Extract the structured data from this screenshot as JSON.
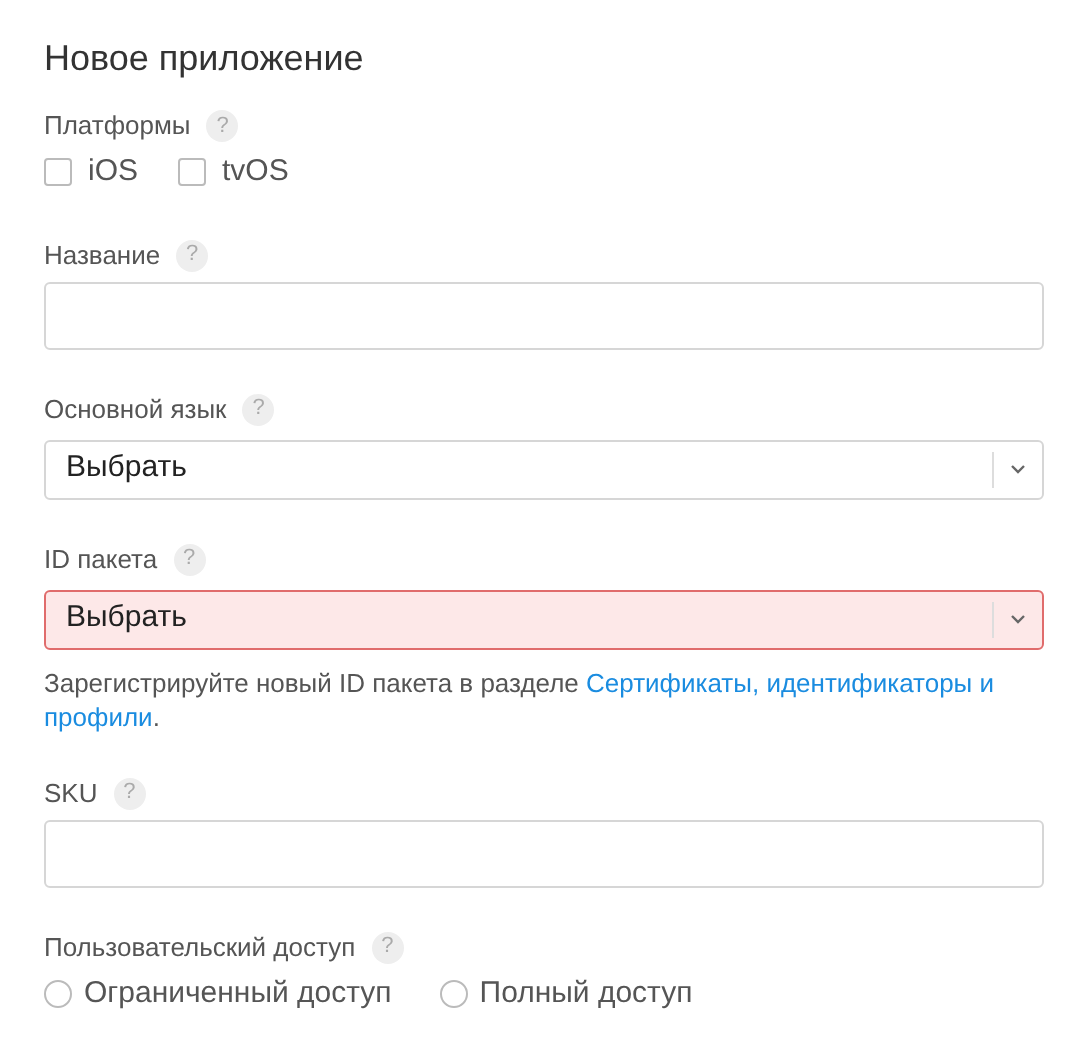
{
  "title": "Новое приложение",
  "fields": [
    {
      "kind": "checkboxes",
      "label": "Платформы",
      "help": "?",
      "options": [
        {
          "label": "iOS",
          "checked": false
        },
        {
          "label": "tvOS",
          "checked": false
        }
      ]
    },
    {
      "kind": "text",
      "label": "Название",
      "help": "?"
    },
    {
      "kind": "select",
      "label": "Основной язык",
      "help": "?",
      "value": "Выбрать",
      "error": false
    },
    {
      "kind": "select",
      "label": "ID пакета",
      "help": "?",
      "value": "Выбрать",
      "error": true,
      "note": {
        "text": "Зарегистрируйте новый ID пакета в разделе",
        "links": [
          "Сертификаты, идентификаторы и",
          "профили"
        ],
        "end": "."
      }
    },
    {
      "kind": "text",
      "label": "SKU",
      "help": "?"
    },
    {
      "kind": "radios",
      "label": "Пользовательский доступ",
      "help": "?",
      "options": [
        {
          "label": "Ограниченный доступ",
          "selected": false
        },
        {
          "label": "Полный доступ",
          "selected": false
        }
      ]
    }
  ]
}
